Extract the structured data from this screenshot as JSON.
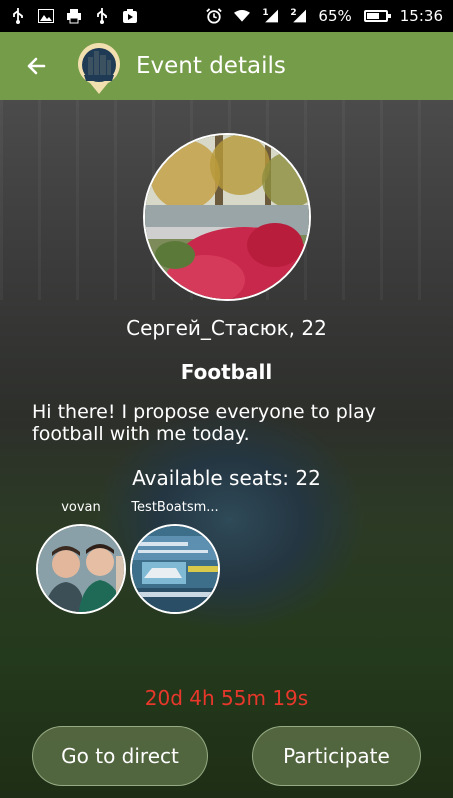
{
  "status_bar": {
    "battery_percent": "65%",
    "battery_level": 0.65,
    "time": "15:36",
    "sim1": "1",
    "sim2": "2",
    "icons_left": [
      "usb-icon",
      "image-icon",
      "printer-icon",
      "usb-icon",
      "media-icon"
    ],
    "icons_right": [
      "alarm-icon",
      "wifi-icon",
      "signal-icon",
      "signal-icon",
      "battery-icon"
    ]
  },
  "app_bar": {
    "title": "Event details",
    "back_icon": "back-arrow-icon",
    "logo_icon": "city-logo-icon",
    "color": "#759c48"
  },
  "event": {
    "organizer_line": "Сергей_Стасюк, 22",
    "name": "Football",
    "description": "Hi there! I propose everyone to play football with me today.",
    "seats_label": "Available seats: 22",
    "countdown": "20d 4h 55m 19s",
    "countdown_color": "#e8372b"
  },
  "participants": [
    {
      "name": "vovan"
    },
    {
      "name": "TestBoatsm..."
    }
  ],
  "buttons": {
    "direct": "Go to direct",
    "participate": "Participate"
  }
}
